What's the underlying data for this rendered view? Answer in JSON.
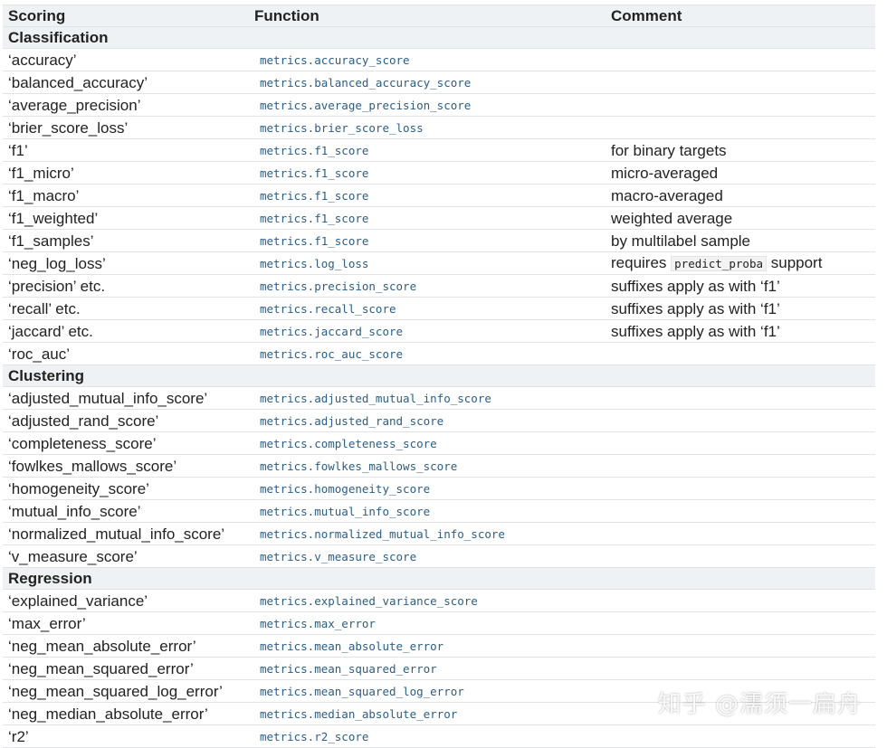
{
  "header": {
    "scoring": "Scoring",
    "function": "Function",
    "comment": "Comment"
  },
  "groups": [
    {
      "title": "Classification",
      "rows": [
        {
          "scoring": "‘accuracy’",
          "function": "metrics.accuracy_score",
          "comment": ""
        },
        {
          "scoring": "‘balanced_accuracy’",
          "function": "metrics.balanced_accuracy_score",
          "comment": ""
        },
        {
          "scoring": "‘average_precision’",
          "function": "metrics.average_precision_score",
          "comment": ""
        },
        {
          "scoring": "‘brier_score_loss’",
          "function": "metrics.brier_score_loss",
          "comment": ""
        },
        {
          "scoring": "‘f1’",
          "function": "metrics.f1_score",
          "comment": "for binary targets"
        },
        {
          "scoring": "‘f1_micro’",
          "function": "metrics.f1_score",
          "comment": "micro-averaged"
        },
        {
          "scoring": "‘f1_macro’",
          "function": "metrics.f1_score",
          "comment": "macro-averaged"
        },
        {
          "scoring": "‘f1_weighted’",
          "function": "metrics.f1_score",
          "comment": "weighted average"
        },
        {
          "scoring": "‘f1_samples’",
          "function": "metrics.f1_score",
          "comment": "by multilabel sample"
        },
        {
          "scoring": "‘neg_log_loss’",
          "function": "metrics.log_loss",
          "comment_pre": "requires",
          "comment_code": "predict_proba",
          "comment_post": "support"
        },
        {
          "scoring": "‘precision’ etc.",
          "function": "metrics.precision_score",
          "comment": "suffixes apply as with ‘f1’"
        },
        {
          "scoring": "‘recall’ etc.",
          "function": "metrics.recall_score",
          "comment": "suffixes apply as with ‘f1’"
        },
        {
          "scoring": "‘jaccard’ etc.",
          "function": "metrics.jaccard_score",
          "comment": "suffixes apply as with ‘f1’"
        },
        {
          "scoring": "‘roc_auc’",
          "function": "metrics.roc_auc_score",
          "comment": ""
        }
      ]
    },
    {
      "title": "Clustering",
      "rows": [
        {
          "scoring": "‘adjusted_mutual_info_score’",
          "function": "metrics.adjusted_mutual_info_score",
          "comment": ""
        },
        {
          "scoring": "‘adjusted_rand_score’",
          "function": "metrics.adjusted_rand_score",
          "comment": ""
        },
        {
          "scoring": "‘completeness_score’",
          "function": "metrics.completeness_score",
          "comment": ""
        },
        {
          "scoring": "‘fowlkes_mallows_score’",
          "function": "metrics.fowlkes_mallows_score",
          "comment": ""
        },
        {
          "scoring": "‘homogeneity_score’",
          "function": "metrics.homogeneity_score",
          "comment": ""
        },
        {
          "scoring": "‘mutual_info_score’",
          "function": "metrics.mutual_info_score",
          "comment": ""
        },
        {
          "scoring": "‘normalized_mutual_info_score’",
          "function": "metrics.normalized_mutual_info_score",
          "comment": ""
        },
        {
          "scoring": "‘v_measure_score’",
          "function": "metrics.v_measure_score",
          "comment": ""
        }
      ]
    },
    {
      "title": "Regression",
      "rows": [
        {
          "scoring": "‘explained_variance’",
          "function": "metrics.explained_variance_score",
          "comment": ""
        },
        {
          "scoring": "‘max_error’",
          "function": "metrics.max_error",
          "comment": ""
        },
        {
          "scoring": "‘neg_mean_absolute_error’",
          "function": "metrics.mean_absolute_error",
          "comment": ""
        },
        {
          "scoring": "‘neg_mean_squared_error’",
          "function": "metrics.mean_squared_error",
          "comment": ""
        },
        {
          "scoring": "‘neg_mean_squared_log_error’",
          "function": "metrics.mean_squared_log_error",
          "comment": ""
        },
        {
          "scoring": "‘neg_median_absolute_error’",
          "function": "metrics.median_absolute_error",
          "comment": ""
        },
        {
          "scoring": "‘r2’",
          "function": "metrics.r2_score",
          "comment": ""
        }
      ]
    }
  ],
  "watermark": "知乎 @濡须一扁舟",
  "colors": {
    "function_link": "#2c5d86",
    "group_background": "#eef2f4",
    "border": "#e1e4e5"
  }
}
